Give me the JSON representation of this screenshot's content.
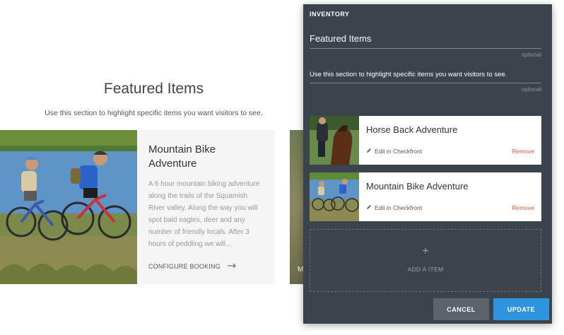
{
  "page": {
    "title": "Featured Items",
    "subtitle": "Use this section to highlight specific items you want visitors to see.",
    "card": {
      "title": "Mountain Bike Adventure",
      "description": "A 6 hour mountain biking adventure along the trails of the Squamish River valley. Along the way you will spot bald eagles, deer and any number of friendly locals. After 3 hours of peddling we will...",
      "cta": "CONFIGURE BOOKING"
    },
    "card2_partial_text": "M"
  },
  "panel": {
    "header": "INVENTORY",
    "title_field": {
      "value": "Featured Items",
      "hint": "optional"
    },
    "desc_field": {
      "value": "Use this section to highlight specific items you want visitors to see.",
      "hint": "optional"
    },
    "items": [
      {
        "name": "Horse Back Adventure",
        "edit": "Edit in Checkfront",
        "remove": "Remove"
      },
      {
        "name": "Mountain Bike Adventure",
        "edit": "Edit in Checkfront",
        "remove": "Remove"
      }
    ],
    "add": {
      "plus": "+",
      "label": "ADD A ITEM"
    },
    "buttons": {
      "cancel": "CANCEL",
      "update": "UPDATE"
    }
  },
  "colors": {
    "panel_bg": "#3b434d",
    "accent": "#2f94de",
    "remove": "#e05a40"
  }
}
